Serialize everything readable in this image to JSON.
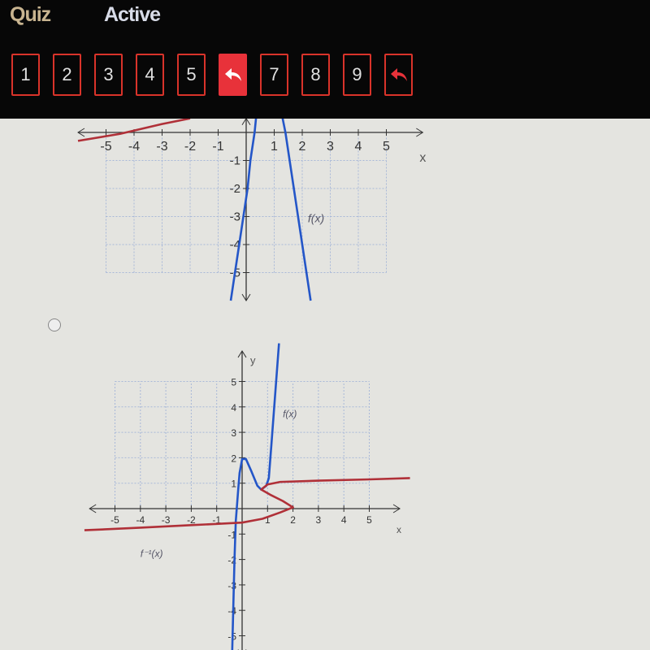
{
  "header": {
    "title": "Quiz",
    "status": "Active"
  },
  "nav": {
    "items": [
      {
        "label": "1",
        "type": "number"
      },
      {
        "label": "2",
        "type": "number"
      },
      {
        "label": "3",
        "type": "number"
      },
      {
        "label": "4",
        "type": "number"
      },
      {
        "label": "5",
        "type": "number"
      },
      {
        "label": "",
        "type": "current",
        "icon": "reply-arrow-icon"
      },
      {
        "label": "7",
        "type": "number"
      },
      {
        "label": "8",
        "type": "number"
      },
      {
        "label": "9",
        "type": "number"
      },
      {
        "label": "",
        "type": "flag",
        "icon": "reply-arrow-icon"
      }
    ]
  },
  "colors": {
    "accent": "#e8323a",
    "f_curve": "#2456c8",
    "inverse_curve": "#b03038",
    "grid": "#a8b8d8"
  },
  "chart_data": [
    {
      "type": "line",
      "xlabel": "x",
      "ylabel": "",
      "xticks": [
        "-5",
        "-4",
        "-3",
        "-2",
        "-1",
        "1",
        "2",
        "3",
        "4",
        "5"
      ],
      "yticks": [
        "-1",
        "-2",
        "-3",
        "-4",
        "-5"
      ],
      "labels": [
        {
          "text": "f(x)"
        }
      ],
      "series": [
        {
          "name": "f(x)",
          "color": "#2456c8",
          "points": [
            [
              -0.55,
              -6
            ],
            [
              -0.4,
              -5
            ],
            [
              -0.25,
              -4
            ],
            [
              -0.1,
              -3
            ],
            [
              0.05,
              -2
            ],
            [
              0.15,
              -1
            ],
            [
              0.3,
              0
            ],
            [
              0.35,
              0.5
            ]
          ]
        },
        {
          "name": "f(x)",
          "color": "#2456c8",
          "points": [
            [
              1.3,
              0.5
            ],
            [
              1.4,
              0
            ],
            [
              1.55,
              -1
            ],
            [
              1.7,
              -2
            ],
            [
              1.85,
              -3
            ],
            [
              2.0,
              -4
            ],
            [
              2.15,
              -5
            ],
            [
              2.3,
              -6
            ]
          ]
        },
        {
          "name": "",
          "color": "#b03038",
          "points": [
            [
              -6,
              -0.3
            ],
            [
              -4.5,
              -0.05
            ],
            [
              -3,
              0.3
            ],
            [
              -2,
              0.5
            ]
          ]
        }
      ]
    },
    {
      "type": "line",
      "xlabel": "x",
      "ylabel": "y",
      "xticks": [
        "-5",
        "-4",
        "-3",
        "-2",
        "-1",
        "1",
        "2",
        "3",
        "4",
        "5"
      ],
      "yticks": [
        "5",
        "4",
        "3",
        "2",
        "1",
        "-1",
        "-2",
        "-3",
        "-4",
        "-5"
      ],
      "labels": [
        {
          "text": "f(x)"
        },
        {
          "text": "f⁻¹(x)"
        }
      ],
      "series": [
        {
          "name": "f(x)",
          "color": "#2456c8",
          "points": [
            [
              -0.4,
              -6
            ],
            [
              -0.35,
              -4
            ],
            [
              -0.3,
              -2
            ],
            [
              -0.25,
              -0.5
            ],
            [
              -0.15,
              0.8
            ],
            [
              -0.1,
              1.4
            ],
            [
              0,
              1.95
            ],
            [
              0.15,
              1.95
            ],
            [
              0.35,
              1.5
            ],
            [
              0.6,
              0.9
            ],
            [
              0.75,
              0.75
            ],
            [
              0.95,
              0.9
            ],
            [
              1.05,
              1.2
            ],
            [
              1.15,
              2.5
            ],
            [
              1.3,
              4.5
            ],
            [
              1.45,
              6.5
            ]
          ]
        },
        {
          "name": "f⁻¹(x)",
          "color": "#b03038",
          "points": [
            [
              -6.2,
              -0.85
            ],
            [
              -4,
              -0.75
            ],
            [
              -2,
              -0.65
            ],
            [
              -1,
              -0.6
            ],
            [
              0,
              -0.55
            ],
            [
              0.8,
              -0.4
            ],
            [
              1.5,
              -0.15
            ],
            [
              2,
              0.05
            ],
            [
              1.6,
              0.3
            ],
            [
              1.1,
              0.55
            ],
            [
              0.75,
              0.75
            ],
            [
              1,
              0.95
            ],
            [
              1.5,
              1.05
            ],
            [
              3,
              1.1
            ],
            [
              5,
              1.15
            ],
            [
              6.6,
              1.2
            ]
          ]
        }
      ]
    }
  ]
}
